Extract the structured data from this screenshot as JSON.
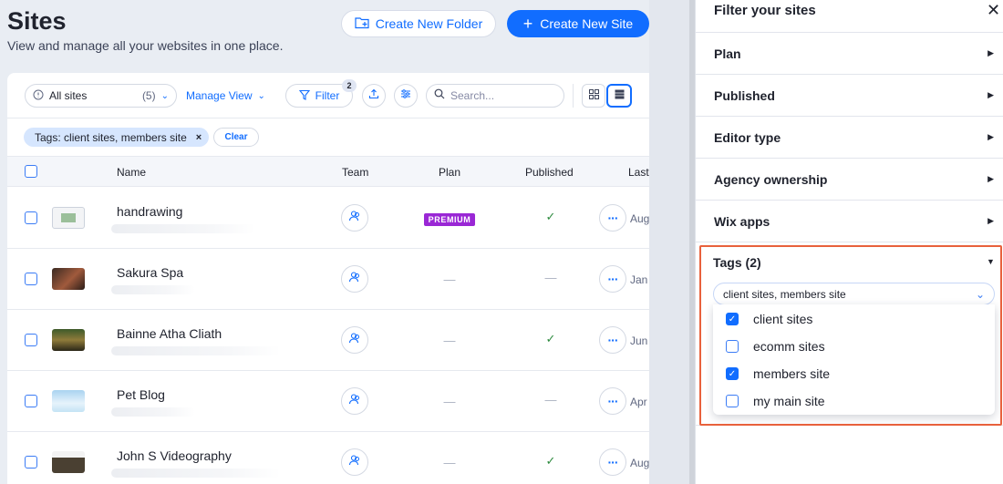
{
  "header": {
    "title": "Sites",
    "subtitle": "View and manage all your websites in one place.",
    "create_folder_label": "Create New Folder",
    "create_site_label": "Create New Site"
  },
  "toolbar": {
    "view_label": "All sites",
    "view_count": "(5)",
    "manage_view_label": "Manage View",
    "filter_label": "Filter",
    "filter_badge": "2",
    "search_placeholder": "Search..."
  },
  "active_filter": {
    "chip_prefix": "Tags:",
    "chip_value": "client sites, members site",
    "clear_label": "Clear"
  },
  "table": {
    "columns": {
      "name": "Name",
      "team": "Team",
      "plan": "Plan",
      "published": "Published",
      "last": "Last"
    },
    "rows": [
      {
        "name": "handrawing",
        "plan": "PREMIUM",
        "published": "✓",
        "last": "Aug"
      },
      {
        "name": "Sakura Spa",
        "plan": "—",
        "published": "—",
        "last": "Jan"
      },
      {
        "name": "Bainne Atha Cliath",
        "plan": "—",
        "published": "✓",
        "last": "Jun"
      },
      {
        "name": "Pet Blog",
        "plan": "—",
        "published": "—",
        "last": "Apr"
      },
      {
        "name": "John S Videography",
        "plan": "—",
        "published": "✓",
        "last": "Aug"
      }
    ]
  },
  "filter_panel": {
    "title": "Filter your sites",
    "sections": [
      "Plan",
      "Published",
      "Editor type",
      "Agency ownership",
      "Wix apps"
    ],
    "tags_label": "Tags (2)",
    "tags_selected": "client sites, members site",
    "tag_options": [
      {
        "label": "client sites",
        "checked": true
      },
      {
        "label": "ecomm sites",
        "checked": false
      },
      {
        "label": "members site",
        "checked": true
      },
      {
        "label": "my main site",
        "checked": false
      }
    ]
  },
  "colors": {
    "accent": "#116dff",
    "premium": "#9a27d5",
    "highlight": "#e8613c",
    "check": "#2e8b3f"
  }
}
